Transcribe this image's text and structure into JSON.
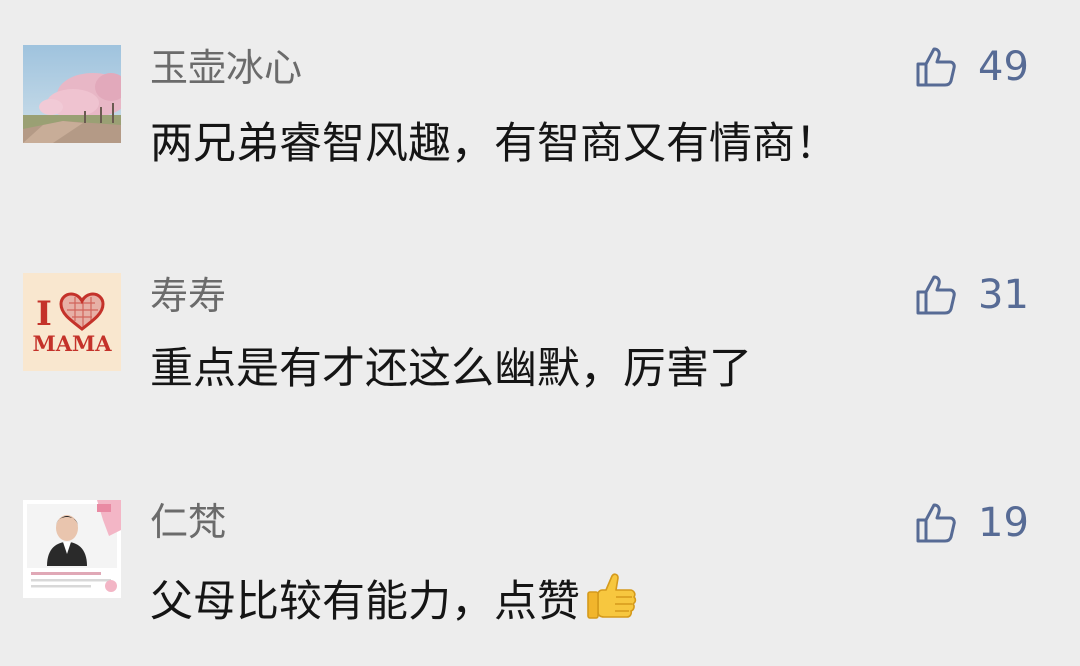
{
  "comments": [
    {
      "author": "玉壶冰心",
      "text": "两兄弟睿智风趣，有智商又有情商！",
      "likes": "49",
      "avatar_icon": "cherry-blossom-avenue-photo"
    },
    {
      "author": "寿寿",
      "text": "重点是有才还这么幽默，厉害了",
      "likes": "31",
      "avatar_icon": "i-love-mama-logo",
      "avatar_text_top": "I",
      "avatar_text_bottom": "MAMA"
    },
    {
      "author": "仁梵",
      "text": "父母比较有能力，点赞",
      "likes": "19",
      "avatar_icon": "woman-portrait-card",
      "trailing_emoji": "thumbs-up-emoji"
    }
  ],
  "colors": {
    "background": "#ededed",
    "author": "#6b6b6b",
    "comment_text": "#151515",
    "like": "#576b95"
  }
}
